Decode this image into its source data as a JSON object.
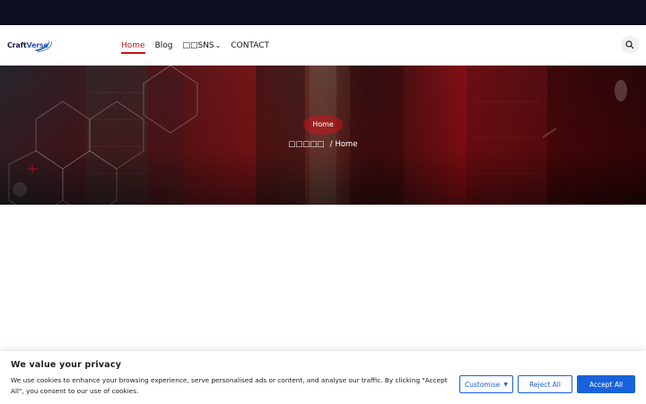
{
  "site": {
    "logo_text_a": "Craft",
    "logo_text_b": "Verse"
  },
  "nav": {
    "items": [
      {
        "label": "Home",
        "active": true
      },
      {
        "label": "Blog",
        "active": false
      },
      {
        "label": "□□SNS",
        "active": false,
        "has_dropdown": true
      },
      {
        "label": "CONTACT",
        "active": false
      }
    ],
    "search_icon": "search-icon"
  },
  "hero": {
    "title": "Home",
    "breadcrumb_root": "□□□□□",
    "breadcrumb_separator": "/",
    "breadcrumb_current": "Home"
  },
  "cookie": {
    "title": "We value your privacy",
    "text": "We use cookies to enhance your browsing experience, serve personalised ads or content, and analyse our traffic. By clicking \"Accept All\", you consent to our use of cookies.",
    "customise_label": "Customise",
    "reject_label": "Reject All",
    "accept_label": "Accept All"
  },
  "colors": {
    "accent": "#c4161c",
    "cookie_button": "#1863dc",
    "topbar": "#0f0f24"
  }
}
